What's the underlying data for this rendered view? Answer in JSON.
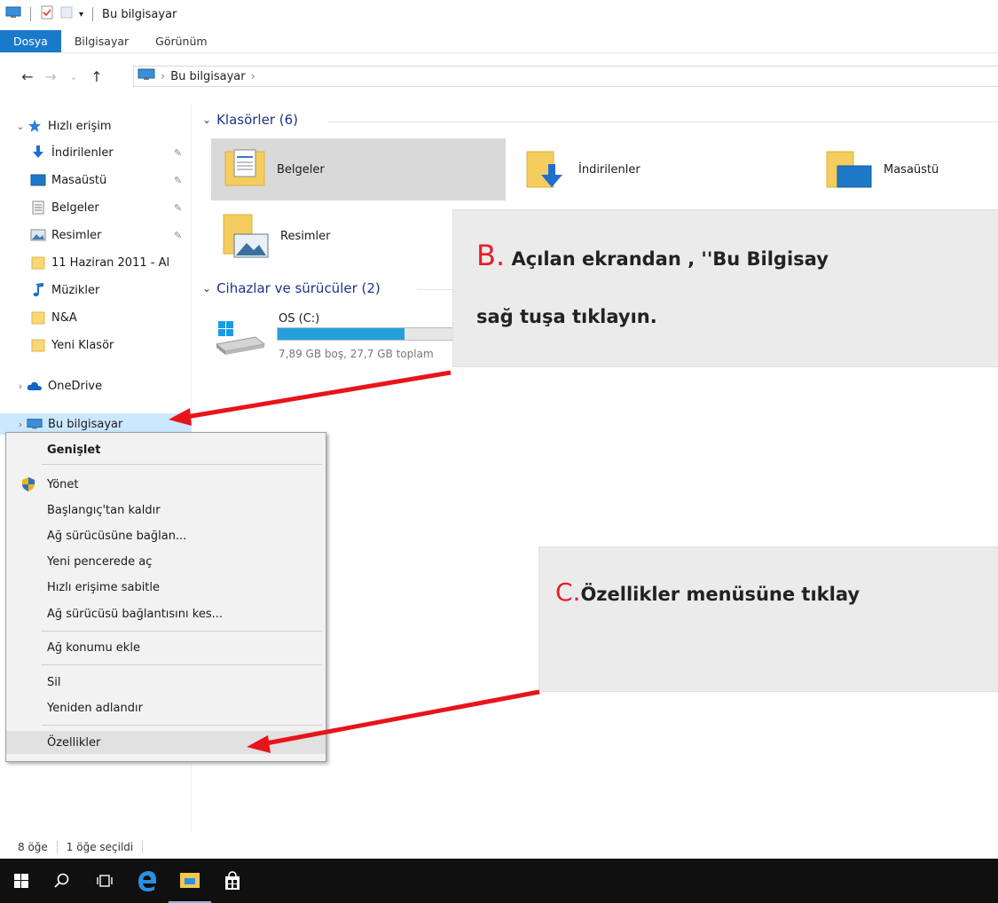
{
  "window": {
    "title": "Bu bilgisayar"
  },
  "ribbon": {
    "tabs": [
      "Dosya",
      "Bilgisayar",
      "Görünüm"
    ]
  },
  "address": {
    "path": [
      "Bu bilgisayar"
    ]
  },
  "nav_pane": {
    "quick_access": "Hızlı erişim",
    "items": [
      {
        "label": "İndirilenler",
        "icon": "download-icon",
        "pinned": true
      },
      {
        "label": "Masaüstü",
        "icon": "desktop-icon",
        "pinned": true
      },
      {
        "label": "Belgeler",
        "icon": "documents-icon",
        "pinned": true
      },
      {
        "label": "Resimler",
        "icon": "pictures-icon",
        "pinned": true
      },
      {
        "label": "11 Haziran 2011 - Al",
        "icon": "folder-icon",
        "pinned": false
      },
      {
        "label": "Müzikler",
        "icon": "music-icon",
        "pinned": false
      },
      {
        "label": "N&A",
        "icon": "folder-icon",
        "pinned": false
      },
      {
        "label": "Yeni Klasör",
        "icon": "folder-icon",
        "pinned": false
      }
    ],
    "onedrive": "OneDrive",
    "this_pc": "Bu bilgisayar"
  },
  "content": {
    "folders_header": "Klasörler (6)",
    "folders": [
      "Belgeler",
      "İndirilenler",
      "Masaüstü",
      "Resimler"
    ],
    "devices_header": "Cihazlar ve sürücüler (2)",
    "drive": {
      "name": "OS (C:)",
      "info": "7,89 GB boş, 27,7 GB toplam",
      "used_fraction": 0.72
    }
  },
  "context_menu": {
    "items": [
      "Genişlet",
      "Yönet",
      "Başlangıç'tan kaldır",
      "Ağ sürücüsüne bağlan...",
      "Yeni pencerede aç",
      "Hızlı erişime sabitle",
      "Ağ sürücüsü bağlantısını kes...",
      "Ağ konumu ekle",
      "Sil",
      "Yeniden adlandır",
      "Özellikler"
    ]
  },
  "callouts": {
    "b_letter": "B.",
    "b_line1": "Açılan ekrandan , ''Bu Bilgisay",
    "b_line2": "sağ tuşa tıklayın.",
    "c_letter": "C.",
    "c_text": "Özellikler menüsüne tıklay"
  },
  "status": {
    "count": "8 öğe",
    "selected": "1 öğe seçildi"
  },
  "colors": {
    "accent": "#1979ca",
    "callout_letter": "#e2202b",
    "arrow": "#e8141b"
  }
}
